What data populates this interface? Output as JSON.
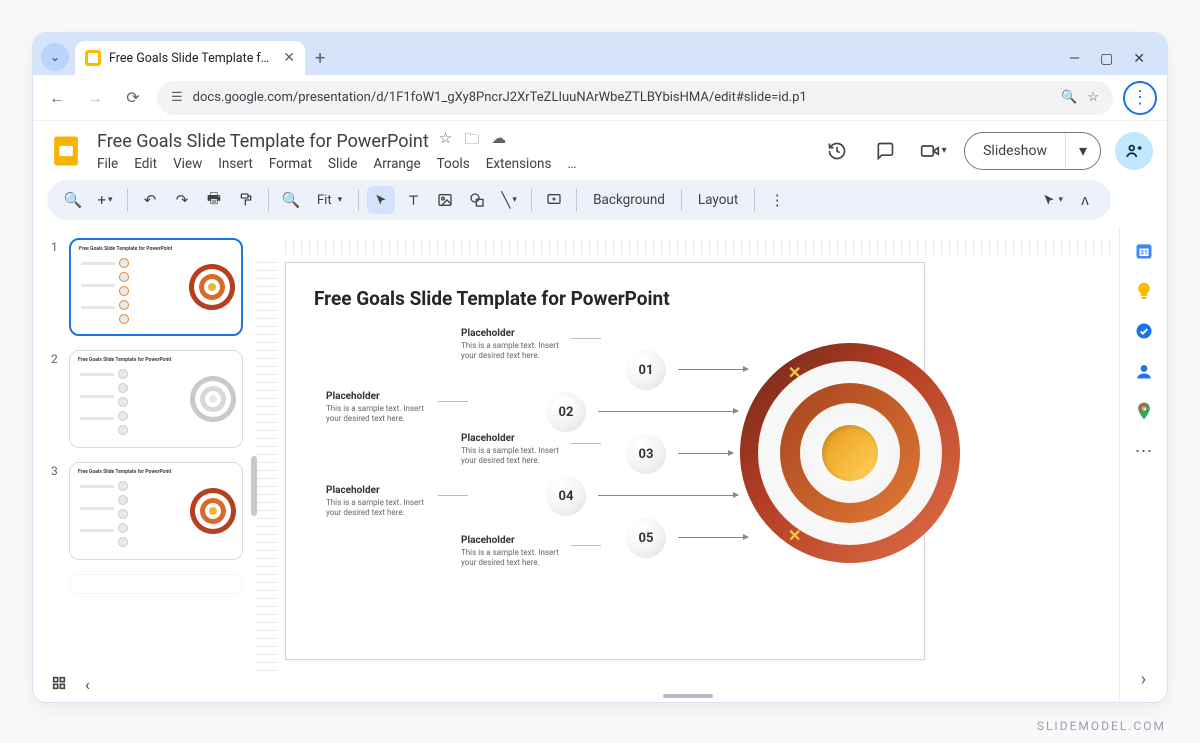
{
  "browser": {
    "tab_title": "Free Goals Slide Template for P",
    "url": "docs.google.com/presentation/d/1F1foW1_gXy8PncrJ2XrTeZLIuuNArWbeZTLBYbisHMA/edit#slide=id.p1"
  },
  "header": {
    "doc_title": "Free Goals Slide Template for PowerPoint",
    "menus": [
      "File",
      "Edit",
      "View",
      "Insert",
      "Format",
      "Slide",
      "Arrange",
      "Tools",
      "Extensions",
      "…"
    ],
    "slideshow_label": "Slideshow"
  },
  "toolbar": {
    "zoom_label": "Fit",
    "background_label": "Background",
    "layout_label": "Layout"
  },
  "thumbnails": [
    "1",
    "2",
    "3"
  ],
  "slide": {
    "title": "Free Goals Slide Template for PowerPoint",
    "placeholders": {
      "p1": {
        "title": "Placeholder",
        "desc": "This is a sample text. Insert your desired text here."
      },
      "p2": {
        "title": "Placeholder",
        "desc": "This is a sample text. Insert your desired text here."
      },
      "p3": {
        "title": "Placeholder",
        "desc": "This is a sample text. Insert your desired text here."
      },
      "p4": {
        "title": "Placeholder",
        "desc": "This is a sample text. Insert your desired text here."
      },
      "p5": {
        "title": "Placeholder",
        "desc": "This is a sample text. Insert your desired text here."
      }
    },
    "bubbles": [
      "01",
      "02",
      "03",
      "04",
      "05"
    ]
  },
  "watermark": "SLIDEMODEL.COM"
}
